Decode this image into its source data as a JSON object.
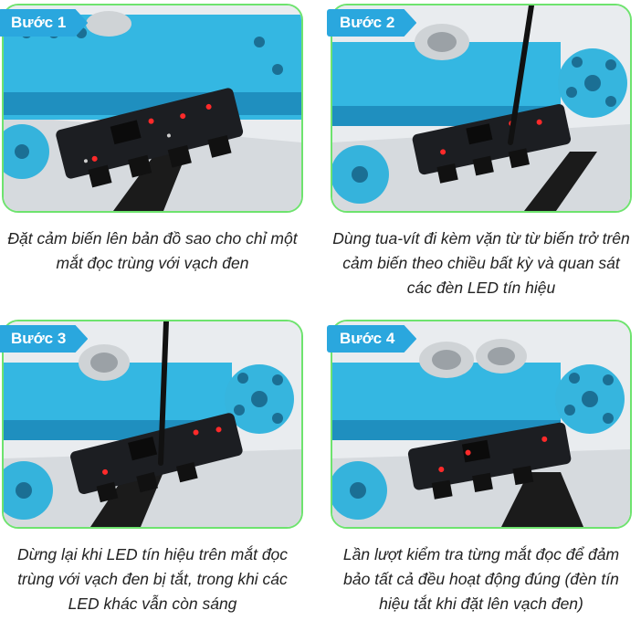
{
  "steps": [
    {
      "badge": "Bước 1",
      "caption": "Đặt cảm biến lên bản đồ sao cho chỉ một mắt đọc trùng với vạch đen"
    },
    {
      "badge": "Bước 2",
      "caption": "Dùng tua-vít đi kèm vặn từ từ biến trở trên cảm biến theo chiều bất kỳ và quan sát các đèn LED tín hiệu"
    },
    {
      "badge": "Bước 3",
      "caption": "Dừng lại khi LED tín hiệu trên mắt đọc trùng với vạch đen bị tắt, trong khi các LED khác vẫn còn sáng"
    },
    {
      "badge": "Bước 4",
      "caption": "Lần lượt kiểm tra từng mắt đọc để đảm bảo tất cả đều hoạt động đúng (đèn tín hiệu tắt khi đặt lên vạch đen)"
    }
  ],
  "colors": {
    "badge": "#2aa7de",
    "frame": "#6ee36e",
    "robot": "#33b6e0",
    "board": "#1c1e22",
    "led_on": "#ff2a2a"
  }
}
